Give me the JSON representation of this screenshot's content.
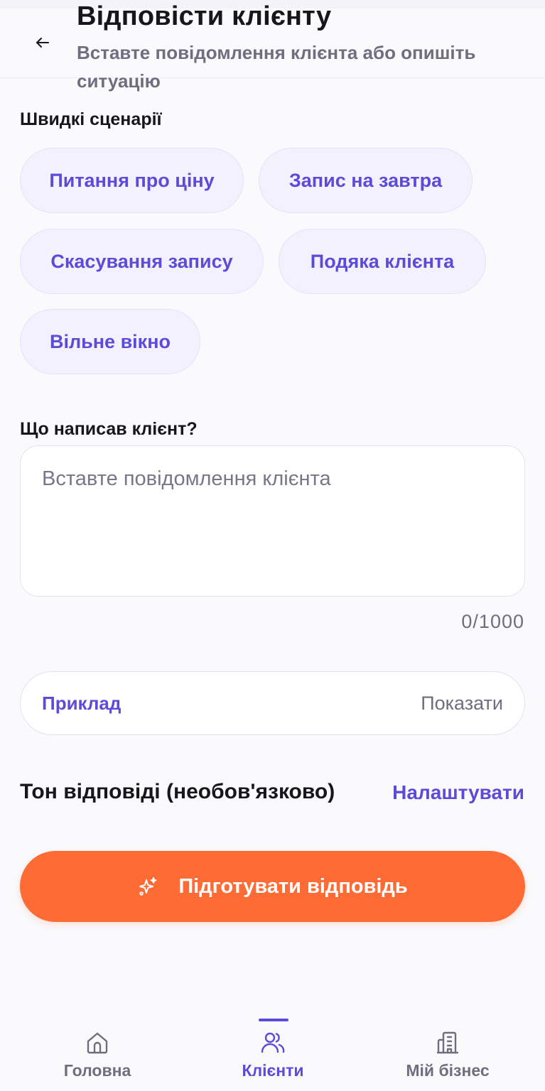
{
  "header": {
    "title": "Відповісти клієнту",
    "subtitle": "Вставте повідомлення клієнта або опишіть ситуацію"
  },
  "scenarios": {
    "label": "Швидкі сценарії",
    "chips": [
      "Питання про ціну",
      "Запис на завтра",
      "Скасування запису",
      "Подяка клієнта",
      "Вільне вікно"
    ]
  },
  "message": {
    "label": "Що написав клієнт?",
    "placeholder": "Вставте повідомлення клієнта",
    "counter": "0/1000"
  },
  "example": {
    "label": "Приклад",
    "toggle": "Показати"
  },
  "tone": {
    "label": "Тон відповіді (необов'язково)",
    "action": "Налаштувати"
  },
  "primary_button": {
    "label": "Підготувати відповідь"
  },
  "bottom_nav": {
    "items": [
      {
        "label": "Головна",
        "icon": "home-icon"
      },
      {
        "label": "Клієнти",
        "icon": "users-icon",
        "active": true
      },
      {
        "label": "Мій бізнес",
        "icon": "building-icon"
      }
    ]
  },
  "colors": {
    "accent": "#5b4bd9",
    "primary": "#ff6b35",
    "chip_bg": "#f3f1fe"
  }
}
